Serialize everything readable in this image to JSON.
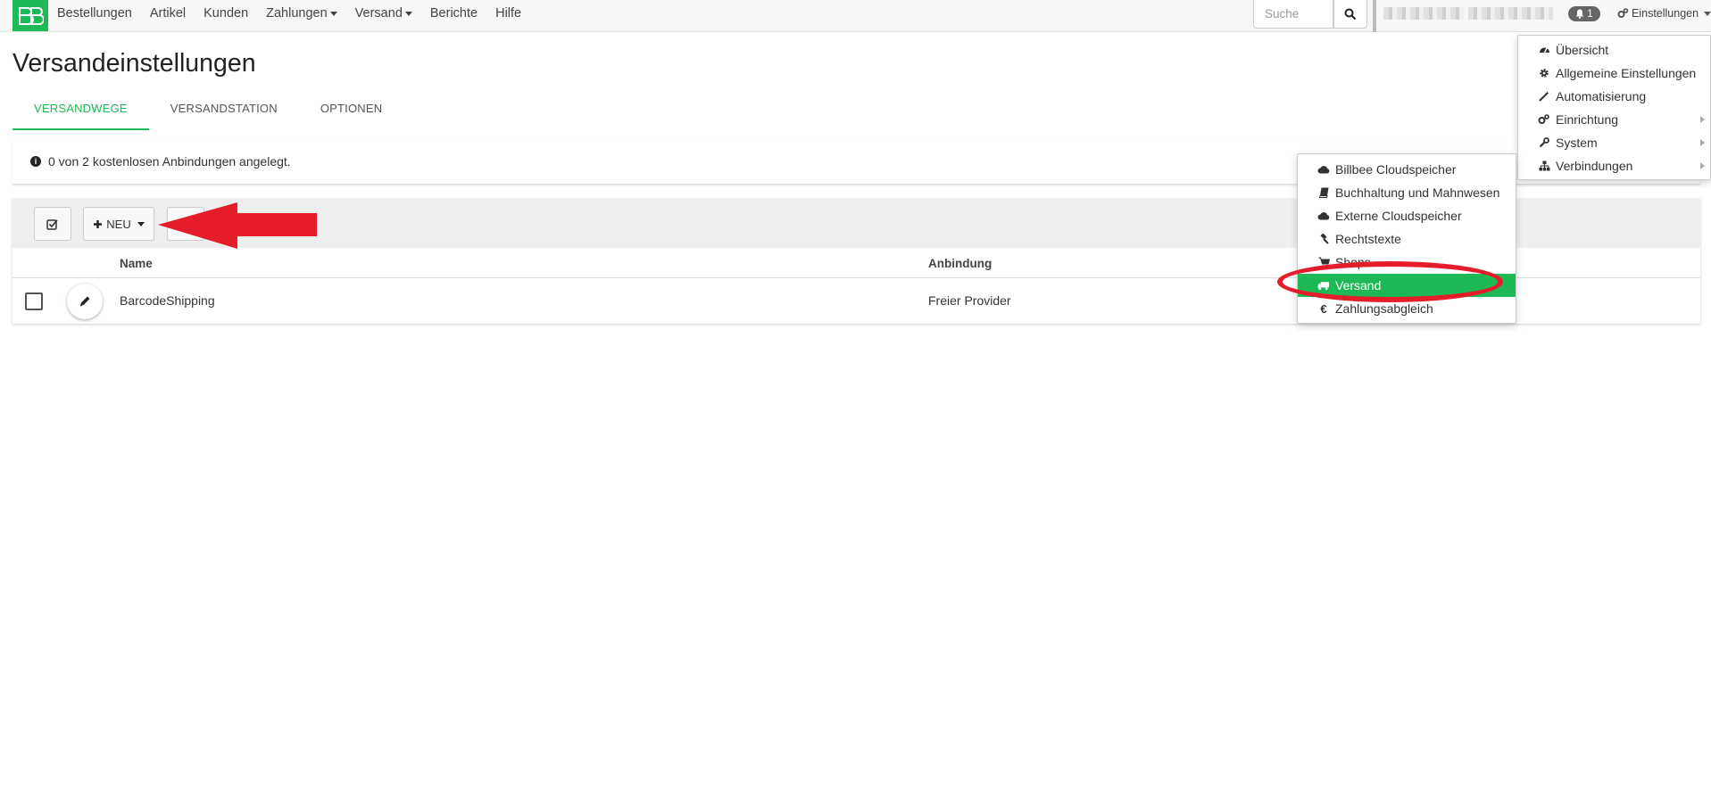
{
  "nav": {
    "items": [
      {
        "label": "Bestellungen",
        "dropdown": false
      },
      {
        "label": "Artikel",
        "dropdown": false
      },
      {
        "label": "Kunden",
        "dropdown": false
      },
      {
        "label": "Zahlungen",
        "dropdown": true
      },
      {
        "label": "Versand",
        "dropdown": true
      },
      {
        "label": "Berichte",
        "dropdown": false
      },
      {
        "label": "Hilfe",
        "dropdown": false
      }
    ],
    "search_placeholder": "Suche",
    "notification_count": "1",
    "settings_label": "Einstellungen"
  },
  "page": {
    "title": "Versandeinstellungen",
    "tabs": [
      {
        "label": "VERSANDWEGE",
        "active": true
      },
      {
        "label": "VERSANDSTATION",
        "active": false
      },
      {
        "label": "OPTIONEN",
        "active": false
      }
    ],
    "info": "0 von 2 kostenlosen Anbindungen angelegt."
  },
  "toolbar": {
    "new_label": "NEU"
  },
  "table": {
    "columns": [
      "Name",
      "Anbindung"
    ],
    "rows": [
      {
        "name": "BarcodeShipping",
        "anbindung": "Freier Provider"
      }
    ]
  },
  "settings_menu": {
    "items": [
      {
        "label": "Übersicht",
        "icon": "dashboard-icon",
        "submenu": false
      },
      {
        "label": "Allgemeine Einstellungen",
        "icon": "gear-icon",
        "submenu": false
      },
      {
        "label": "Automatisierung",
        "icon": "magic-wand-icon",
        "submenu": false
      },
      {
        "label": "Einrichtung",
        "icon": "gears-icon",
        "submenu": true
      },
      {
        "label": "System",
        "icon": "wrench-icon",
        "submenu": true
      },
      {
        "label": "Verbindungen",
        "icon": "sitemap-icon",
        "submenu": true
      }
    ]
  },
  "connections_menu": {
    "items": [
      {
        "label": "Billbee Cloudspeicher",
        "icon": "cloud-icon"
      },
      {
        "label": "Buchhaltung und Mahnwesen",
        "icon": "book-icon"
      },
      {
        "label": "Externe Cloudspeicher",
        "icon": "cloud-icon"
      },
      {
        "label": "Rechtstexte",
        "icon": "gavel-icon"
      },
      {
        "label": "Shops",
        "icon": "cart-icon"
      },
      {
        "label": "Versand",
        "icon": "truck-icon",
        "highlighted": true
      },
      {
        "label": "Zahlungsabgleich",
        "icon": "euro-icon"
      }
    ]
  },
  "colors": {
    "brand": "#1db954",
    "annotation": "#e51d2a"
  }
}
